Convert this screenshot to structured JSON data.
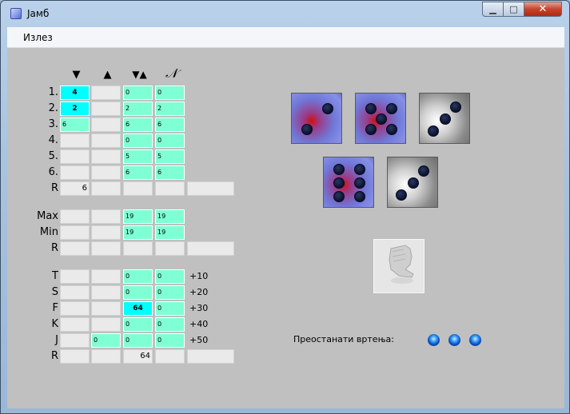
{
  "window": {
    "title": "Јамб"
  },
  "menu": {
    "exit": "Излез"
  },
  "columns": {
    "down_symbol": "▼",
    "up_symbol": "▲",
    "free_symbol": "▼▲",
    "announce_symbol": "𝒩"
  },
  "section1": {
    "rows": [
      {
        "label": "1.",
        "cells": [
          "4",
          "",
          "0",
          "0"
        ]
      },
      {
        "label": "2.",
        "cells": [
          "2",
          "",
          "2",
          "2"
        ]
      },
      {
        "label": "3.",
        "cells": [
          "6",
          "",
          "6",
          "6"
        ]
      },
      {
        "label": "4.",
        "cells": [
          "",
          "",
          "0",
          "0"
        ]
      },
      {
        "label": "5.",
        "cells": [
          "",
          "",
          "5",
          "5"
        ]
      },
      {
        "label": "6.",
        "cells": [
          "",
          "",
          "6",
          "6"
        ]
      }
    ],
    "result": {
      "label": "R",
      "cells": [
        "6",
        "",
        "",
        "",
        ""
      ]
    }
  },
  "section2": {
    "rows": [
      {
        "label": "Max",
        "cells": [
          "",
          "",
          "19",
          "19"
        ]
      },
      {
        "label": "Min",
        "cells": [
          "",
          "",
          "19",
          "19"
        ]
      }
    ],
    "result": {
      "label": "R",
      "cells": [
        "",
        "",
        "",
        "",
        ""
      ]
    }
  },
  "section3": {
    "rows": [
      {
        "label": "T",
        "cells": [
          "",
          "",
          "0",
          "0"
        ],
        "bonus": "+10"
      },
      {
        "label": "S",
        "cells": [
          "",
          "",
          "0",
          "0"
        ],
        "bonus": "+20"
      },
      {
        "label": "F",
        "cells": [
          "",
          "",
          "64",
          "0"
        ],
        "bonus": "+30"
      },
      {
        "label": "K",
        "cells": [
          "",
          "",
          "0",
          "0"
        ],
        "bonus": "+40"
      },
      {
        "label": "J",
        "cells": [
          "",
          "0",
          "0",
          "0"
        ],
        "bonus": "+50"
      }
    ],
    "result": {
      "label": "R",
      "cells": [
        "",
        "",
        "64",
        "",
        ""
      ]
    }
  },
  "dice": [
    {
      "value": 2,
      "held": true
    },
    {
      "value": 5,
      "held": true
    },
    {
      "value": 3,
      "held": false
    },
    {
      "value": 6,
      "held": true
    },
    {
      "value": 3,
      "held": false
    }
  ],
  "roll_button": {
    "icon": "fist-icon"
  },
  "rolls": {
    "label": "Преостанати вртења:",
    "remaining": 3
  },
  "colors": {
    "client_bg": "#c0c0c0",
    "possible_cell": "#7fffd4",
    "active_cell": "#00ffff",
    "empty_cell": "#eaeaea"
  }
}
